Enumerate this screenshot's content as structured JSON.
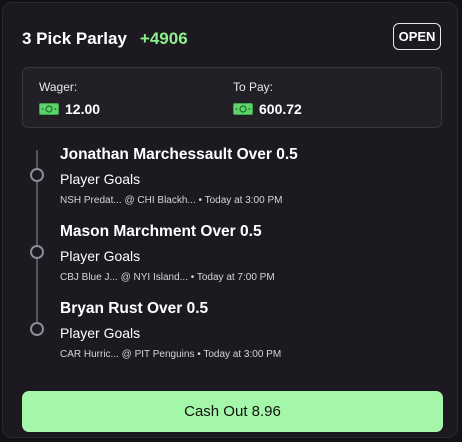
{
  "parlay": {
    "title": "3 Pick Parlay",
    "odds": "+4906",
    "status": "OPEN"
  },
  "wager": {
    "label": "Wager:",
    "amount": "12.00",
    "icon": "cash-icon"
  },
  "payout": {
    "label": "To Pay:",
    "amount": "600.72",
    "icon": "cash-icon"
  },
  "legs": [
    {
      "title": "Jonathan Marchessault Over 0.5",
      "market": "Player Goals",
      "meta": "NSH Predat... @ CHI Blackh... • Today at 3:00 PM"
    },
    {
      "title": "Mason Marchment Over 0.5",
      "market": "Player Goals",
      "meta": "CBJ Blue J... @ NYI Island... • Today at 7:00 PM"
    },
    {
      "title": "Bryan Rust Over 0.5",
      "market": "Player Goals",
      "meta": "CAR Hurric... @ PIT Penguins • Today at 3:00 PM"
    }
  ],
  "cashout": {
    "label": "Cash Out 8.96"
  },
  "colors": {
    "background": "#1c1a20",
    "odds_green": "#8bf08b",
    "cashout_green": "#a4f7a8"
  }
}
